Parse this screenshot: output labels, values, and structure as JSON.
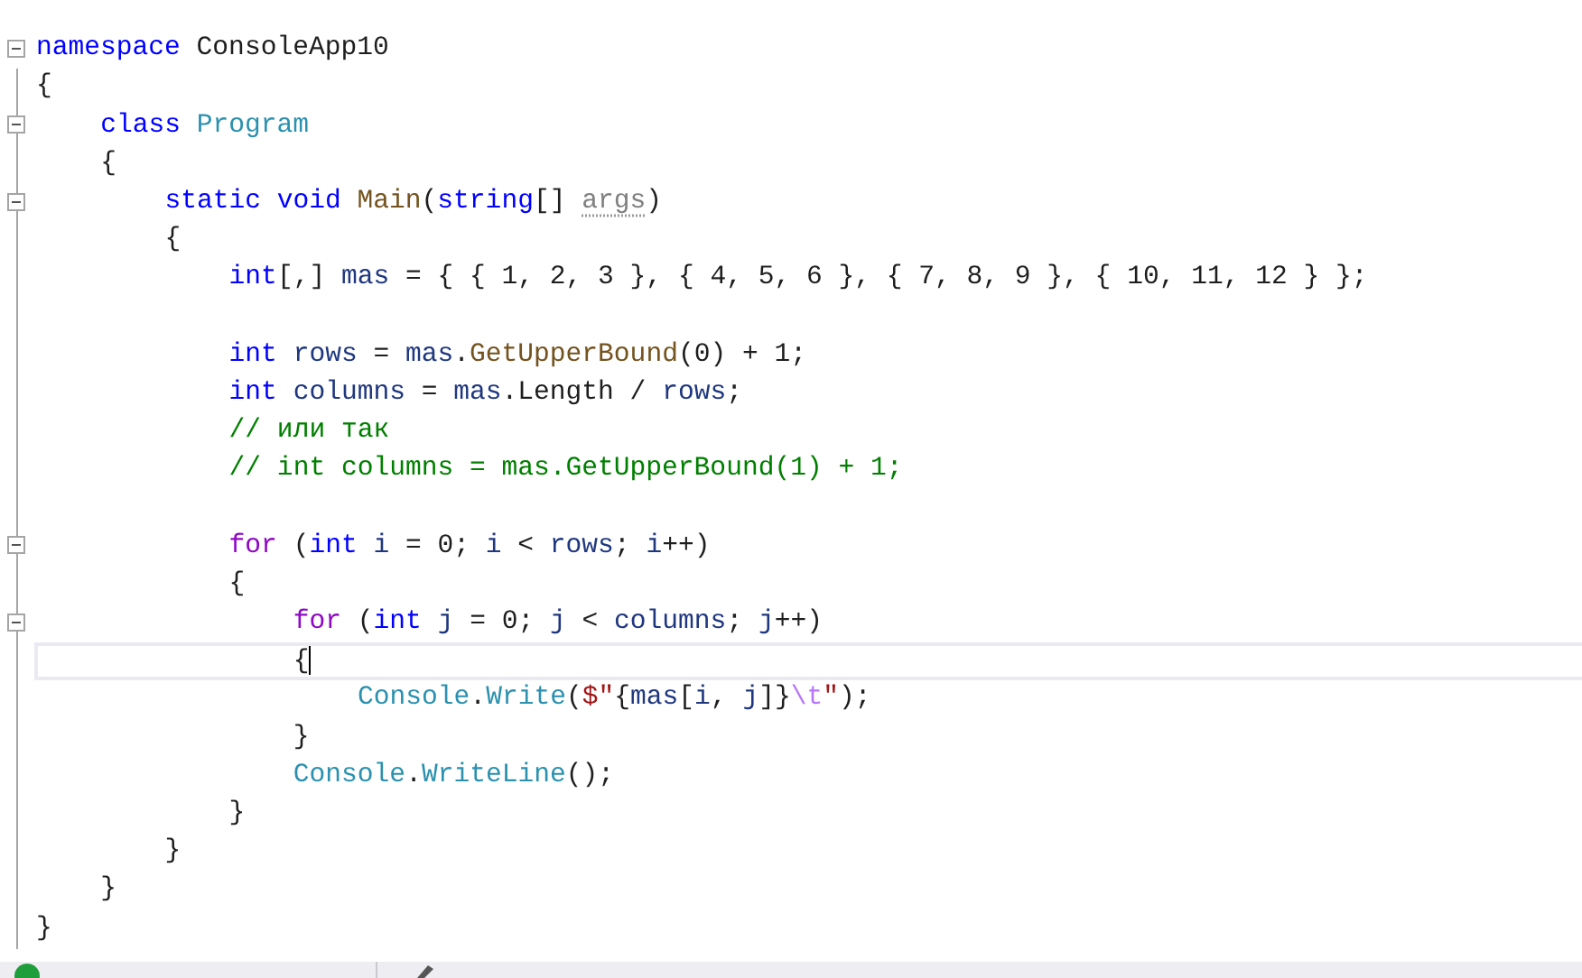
{
  "editor": {
    "lines": [
      {
        "kind": "code",
        "fold": true,
        "tokens": [
          {
            "kind": "kw",
            "text": "namespace"
          },
          {
            "kind": "plain",
            "text": " ConsoleApp10"
          }
        ],
        "children": [
          {
            "kind": "brace",
            "tokens": [
              {
                "kind": "plain",
                "text": "{"
              }
            ]
          },
          {
            "kind": "code",
            "fold": true,
            "tokens": [
              {
                "kind": "kw",
                "text": "class"
              },
              {
                "kind": "type",
                "text": " Program"
              }
            ],
            "children": [
              {
                "kind": "brace",
                "tokens": [
                  {
                    "kind": "plain",
                    "text": "{"
                  }
                ]
              },
              {
                "kind": "code",
                "fold": true,
                "tokens": [
                  {
                    "kind": "kw",
                    "text": "static void"
                  },
                  {
                    "kind": "method",
                    "text": " Main"
                  },
                  {
                    "kind": "plain",
                    "text": "("
                  },
                  {
                    "kind": "kw",
                    "text": "string"
                  },
                  {
                    "kind": "plain",
                    "text": "[] "
                  },
                  {
                    "kind": "param",
                    "text": "args"
                  },
                  {
                    "kind": "plain",
                    "text": ")"
                  }
                ],
                "children": [
                  {
                    "kind": "brace",
                    "tokens": [
                      {
                        "kind": "plain",
                        "text": "{"
                      }
                    ]
                  },
                  {
                    "kind": "code",
                    "tokens": [
                      {
                        "kind": "kw",
                        "text": "int"
                      },
                      {
                        "kind": "plain",
                        "text": "[,] "
                      },
                      {
                        "kind": "local",
                        "text": "mas"
                      },
                      {
                        "kind": "plain",
                        "text": " = { { 1, 2, 3 }, { 4, 5, 6 }, { 7, 8, 9 }, { 10, 11, 12 } };"
                      }
                    ]
                  },
                  {
                    "kind": "blank"
                  },
                  {
                    "kind": "code",
                    "tokens": [
                      {
                        "kind": "kw",
                        "text": "int"
                      },
                      {
                        "kind": "local",
                        "text": " rows"
                      },
                      {
                        "kind": "plain",
                        "text": " = "
                      },
                      {
                        "kind": "local",
                        "text": "mas"
                      },
                      {
                        "kind": "plain",
                        "text": "."
                      },
                      {
                        "kind": "method",
                        "text": "GetUpperBound"
                      },
                      {
                        "kind": "plain",
                        "text": "(0) + 1;"
                      }
                    ]
                  },
                  {
                    "kind": "code",
                    "tokens": [
                      {
                        "kind": "kw",
                        "text": "int"
                      },
                      {
                        "kind": "local",
                        "text": " columns"
                      },
                      {
                        "kind": "plain",
                        "text": " = "
                      },
                      {
                        "kind": "local",
                        "text": "mas"
                      },
                      {
                        "kind": "plain",
                        "text": ".Length / "
                      },
                      {
                        "kind": "local",
                        "text": "rows"
                      },
                      {
                        "kind": "plain",
                        "text": ";"
                      }
                    ]
                  },
                  {
                    "kind": "code",
                    "tokens": [
                      {
                        "kind": "comment",
                        "text": "// или так"
                      }
                    ]
                  },
                  {
                    "kind": "code",
                    "tokens": [
                      {
                        "kind": "comment",
                        "text": "// int columns = mas.GetUpperBound(1) + 1;"
                      }
                    ]
                  },
                  {
                    "kind": "blank"
                  },
                  {
                    "kind": "code",
                    "fold": true,
                    "tokens": [
                      {
                        "kind": "ctl",
                        "text": "for"
                      },
                      {
                        "kind": "plain",
                        "text": " ("
                      },
                      {
                        "kind": "kw",
                        "text": "int"
                      },
                      {
                        "kind": "local",
                        "text": " i"
                      },
                      {
                        "kind": "plain",
                        "text": " = 0; "
                      },
                      {
                        "kind": "local",
                        "text": "i"
                      },
                      {
                        "kind": "plain",
                        "text": " < "
                      },
                      {
                        "kind": "local",
                        "text": "rows"
                      },
                      {
                        "kind": "plain",
                        "text": "; "
                      },
                      {
                        "kind": "local",
                        "text": "i"
                      },
                      {
                        "kind": "plain",
                        "text": "++)"
                      }
                    ],
                    "children": [
                      {
                        "kind": "brace",
                        "tokens": [
                          {
                            "kind": "plain",
                            "text": "{"
                          }
                        ]
                      },
                      {
                        "kind": "code",
                        "fold": true,
                        "tokens": [
                          {
                            "kind": "ctl",
                            "text": "for"
                          },
                          {
                            "kind": "plain",
                            "text": " ("
                          },
                          {
                            "kind": "kw",
                            "text": "int"
                          },
                          {
                            "kind": "local",
                            "text": " j"
                          },
                          {
                            "kind": "plain",
                            "text": " = 0; "
                          },
                          {
                            "kind": "local",
                            "text": "j"
                          },
                          {
                            "kind": "plain",
                            "text": " < "
                          },
                          {
                            "kind": "local",
                            "text": "columns"
                          },
                          {
                            "kind": "plain",
                            "text": "; "
                          },
                          {
                            "kind": "local",
                            "text": "j"
                          },
                          {
                            "kind": "plain",
                            "text": "++)"
                          }
                        ],
                        "children": [
                          {
                            "kind": "brace",
                            "current": true,
                            "tokens": [
                              {
                                "kind": "plain",
                                "text": "{"
                              }
                            ]
                          },
                          {
                            "kind": "code",
                            "tokens": [
                              {
                                "kind": "type",
                                "text": "Console"
                              },
                              {
                                "kind": "plain",
                                "text": "."
                              },
                              {
                                "kind": "type",
                                "text": "Write"
                              },
                              {
                                "kind": "plain",
                                "text": "("
                              },
                              {
                                "kind": "str",
                                "text": "$\""
                              },
                              {
                                "kind": "plain",
                                "text": "{"
                              },
                              {
                                "kind": "local",
                                "text": "mas"
                              },
                              {
                                "kind": "plain",
                                "text": "["
                              },
                              {
                                "kind": "local",
                                "text": "i"
                              },
                              {
                                "kind": "plain",
                                "text": ", "
                              },
                              {
                                "kind": "local",
                                "text": "j"
                              },
                              {
                                "kind": "plain",
                                "text": "]}"
                              },
                              {
                                "kind": "esc",
                                "text": "\\t"
                              },
                              {
                                "kind": "str",
                                "text": "\""
                              },
                              {
                                "kind": "plain",
                                "text": ");"
                              }
                            ]
                          },
                          {
                            "kind": "brace",
                            "tokens": [
                              {
                                "kind": "plain",
                                "text": "}"
                              }
                            ]
                          }
                        ]
                      },
                      {
                        "kind": "code",
                        "tokens": [
                          {
                            "kind": "type",
                            "text": "Console"
                          },
                          {
                            "kind": "plain",
                            "text": "."
                          },
                          {
                            "kind": "type",
                            "text": "WriteLine"
                          },
                          {
                            "kind": "plain",
                            "text": "();"
                          }
                        ]
                      },
                      {
                        "kind": "brace",
                        "tokens": [
                          {
                            "kind": "plain",
                            "text": "}"
                          }
                        ]
                      }
                    ]
                  },
                  {
                    "kind": "brace",
                    "tokens": [
                      {
                        "kind": "plain",
                        "text": "}"
                      }
                    ]
                  }
                ]
              },
              {
                "kind": "brace",
                "tokens": [
                  {
                    "kind": "plain",
                    "text": "}"
                  }
                ]
              }
            ]
          },
          {
            "kind": "brace",
            "tokens": [
              {
                "kind": "plain",
                "text": "}"
              }
            ]
          }
        ]
      }
    ]
  }
}
